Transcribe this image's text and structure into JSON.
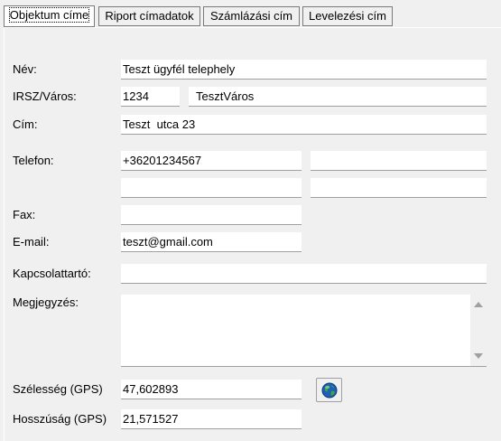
{
  "tabs": [
    {
      "label": "Objektum címe",
      "active": true
    },
    {
      "label": "Riport címadatok",
      "active": false
    },
    {
      "label": "Számlázási cím",
      "active": false
    },
    {
      "label": "Levelezési cím",
      "active": false
    }
  ],
  "form": {
    "name": {
      "label": "Név:",
      "value": "Teszt ügyfél telephely"
    },
    "zip_city": {
      "label": "IRSZ/Város:",
      "zip": "1234",
      "city": "TesztVáros"
    },
    "address": {
      "label": "Cím:",
      "value": "Teszt  utca 23"
    },
    "phone": {
      "label": "Telefon:",
      "phone1": "+36201234567",
      "phone2": "",
      "phone3": "",
      "phone4": ""
    },
    "fax": {
      "label": "Fax:",
      "value": ""
    },
    "email": {
      "label": "E-mail:",
      "value": "teszt@gmail.com"
    },
    "contact": {
      "label": "Kapcsolattartó:",
      "value": ""
    },
    "note": {
      "label": "Megjegyzés:",
      "value": ""
    },
    "latitude": {
      "label": "Szélesség (GPS)",
      "value": "47,602893"
    },
    "longitude": {
      "label": "Hosszúság (GPS)",
      "value": "21,571527"
    }
  },
  "icons": {
    "gps_button": "globe-icon"
  }
}
